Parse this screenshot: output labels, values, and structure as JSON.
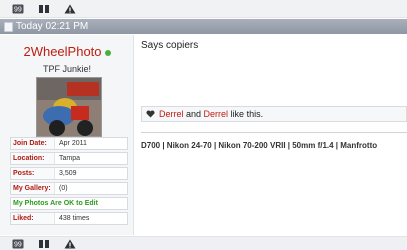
{
  "icons": [
    "quote-icon",
    "report-icon",
    "warning-icon"
  ],
  "date_bar": {
    "timestamp": "Today 02:21 PM"
  },
  "user": {
    "name": "2WheelPhoto",
    "title": "TPF Junkie!",
    "info": [
      {
        "label": "Join Date:",
        "value": "Apr 2011"
      },
      {
        "label": "Location:",
        "value": "Tampa"
      },
      {
        "label": "Posts:",
        "value": "3,509"
      },
      {
        "label": "My Gallery:",
        "value": "(0)"
      }
    ],
    "ok_to_edit": "My Photos Are OK to Edit",
    "liked_label": "Liked:",
    "liked_value": "438 times"
  },
  "post": {
    "body": "Says copiers"
  },
  "likes": {
    "user1": "Derrel",
    "and": " and ",
    "user2": "Derrel",
    "suffix": " like this."
  },
  "signature": "D700 | Nikon 24-70 | Nikon 70-200 VRII | 50mm f/1.4 | Manfrotto"
}
